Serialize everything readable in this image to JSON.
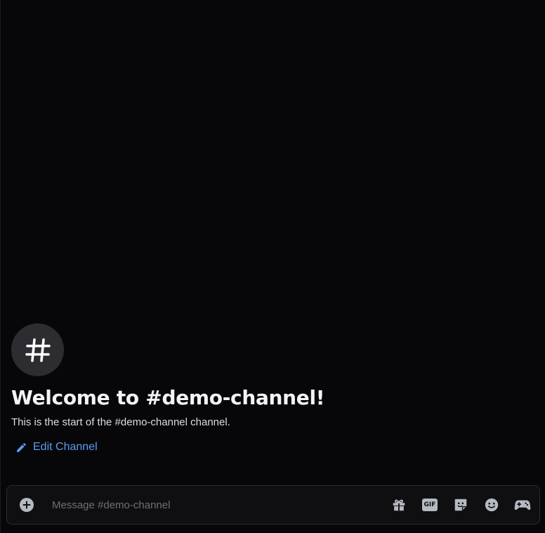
{
  "channel": {
    "avatar_glyph": "#",
    "welcome_title": "Welcome to #demo-channel!",
    "welcome_subtitle": "This is the start of the #demo-channel channel.",
    "edit_label": "Edit Channel"
  },
  "composer": {
    "placeholder": "Message #demo-channel",
    "tools": [
      {
        "icon": "gift-icon"
      },
      {
        "icon": "gif-icon",
        "label": "GIF"
      },
      {
        "icon": "sticker-icon"
      },
      {
        "icon": "emoji-icon"
      },
      {
        "icon": "apps-gamepad-icon"
      }
    ]
  },
  "colors": {
    "background": "#070709",
    "link": "#5b9bf0",
    "icon": "#b5bac1"
  }
}
